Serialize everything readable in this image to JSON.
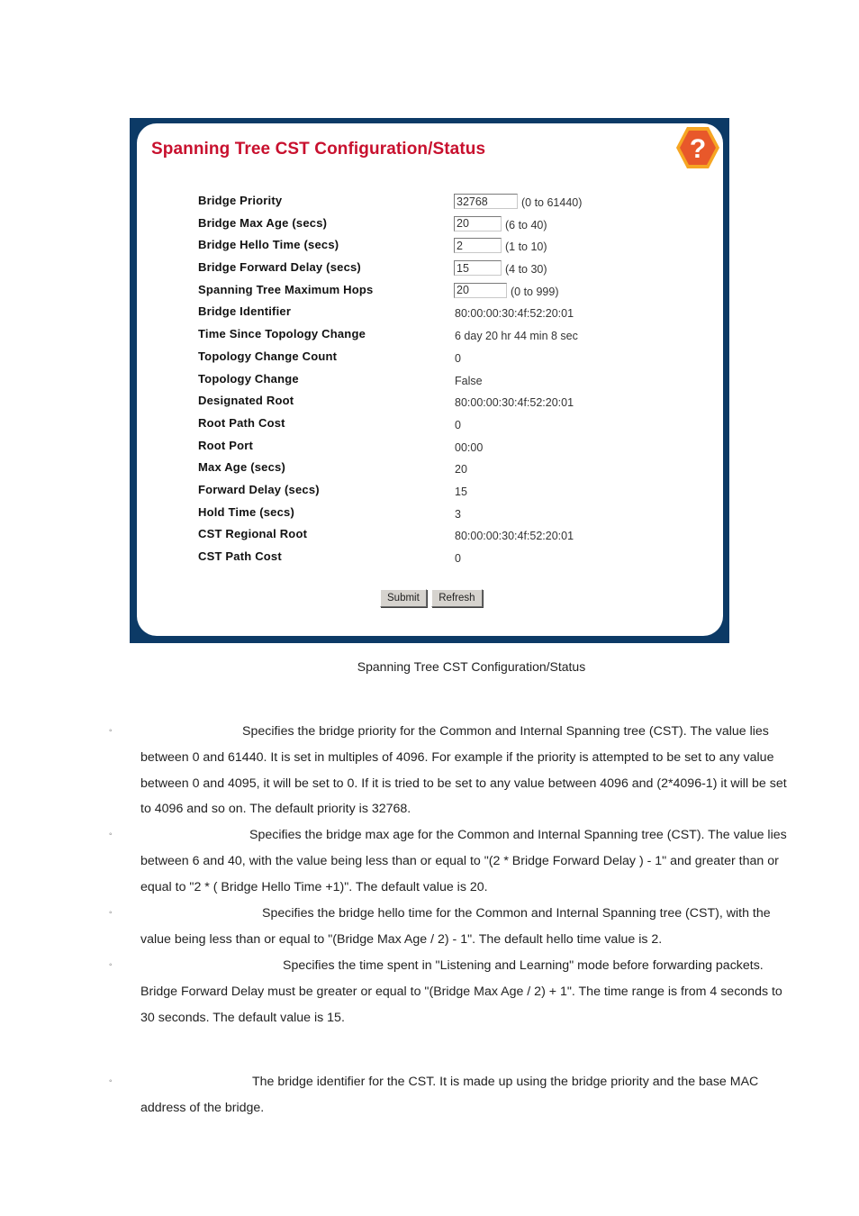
{
  "panel": {
    "title": "Spanning Tree CST Configuration/Status",
    "help_icon": "help-question-icon",
    "config_fields": [
      {
        "label": "Bridge Priority",
        "value": "32768",
        "range": "(0 to 61440)"
      },
      {
        "label": "Bridge Max Age (secs)",
        "value": "20",
        "range": "(6 to 40)"
      },
      {
        "label": "Bridge Hello Time (secs)",
        "value": "2",
        "range": "(1 to 10)"
      },
      {
        "label": "Bridge Forward Delay (secs)",
        "value": "15",
        "range": "(4 to 30)"
      },
      {
        "label": "Spanning Tree Maximum Hops",
        "value": "20",
        "range": "(0 to 999)"
      }
    ],
    "status_fields": [
      {
        "label": "Bridge Identifier",
        "value": "80:00:00:30:4f:52:20:01"
      },
      {
        "label": "Time Since Topology Change",
        "value": "6 day 20 hr 44 min 8 sec"
      },
      {
        "label": "Topology Change Count",
        "value": "0"
      },
      {
        "label": "Topology Change",
        "value": "False"
      },
      {
        "label": "Designated Root",
        "value": "80:00:00:30:4f:52:20:01"
      },
      {
        "label": "Root Path Cost",
        "value": "0"
      },
      {
        "label": "Root Port",
        "value": "00:00"
      },
      {
        "label": "Max Age (secs)",
        "value": "20"
      },
      {
        "label": "Forward Delay (secs)",
        "value": "15"
      },
      {
        "label": "Hold Time (secs)",
        "value": "3"
      },
      {
        "label": "CST Regional Root",
        "value": "80:00:00:30:4f:52:20:01"
      },
      {
        "label": "CST Path Cost",
        "value": "0"
      }
    ],
    "buttons": {
      "submit": "Submit",
      "refresh": "Refresh"
    }
  },
  "caption": "Spanning Tree CST Configuration/Status",
  "descriptions": [
    {
      "bullet": "◦",
      "first_line": "Specifies the bridge priority for the Common and Internal Spanning tree (CST). The value lies",
      "rest": "between 0 and 61440. It is set in multiples of 4096. For example if the priority is attempted to be set to any value between 0 and 4095, it will be set to 0. If it is tried to be set to any value between 4096 and (2*4096-1) it will be set to 4096 and so on. The default priority is 32768."
    },
    {
      "bullet": "◦",
      "first_line": "Specifies the bridge max age for the Common and Internal Spanning tree (CST). The value lies",
      "rest": "between 6 and 40, with the value being less than or equal to \"(2 * Bridge Forward Delay ) - 1\" and greater than or equal to \"2 * ( Bridge Hello Time +1)\". The default value is 20."
    },
    {
      "bullet": "◦",
      "first_line": "Specifies the bridge hello time for the Common and Internal Spanning tree (CST), with the",
      "rest": "value being less than or equal to \"(Bridge Max Age / 2) - 1\". The default hello time value is 2."
    },
    {
      "bullet": "◦",
      "first_line": "Specifies the time spent in \"Listening and Learning\" mode before forwarding packets.",
      "rest": "Bridge Forward Delay must be greater or equal to \"(Bridge Max Age / 2) + 1\". The time range is from 4 seconds to 30 seconds. The default value is 15."
    },
    {
      "bullet": "◦",
      "first_line": "The bridge identifier for the CST. It is made up using the bridge priority and the base MAC",
      "rest": "address of the bridge."
    }
  ]
}
